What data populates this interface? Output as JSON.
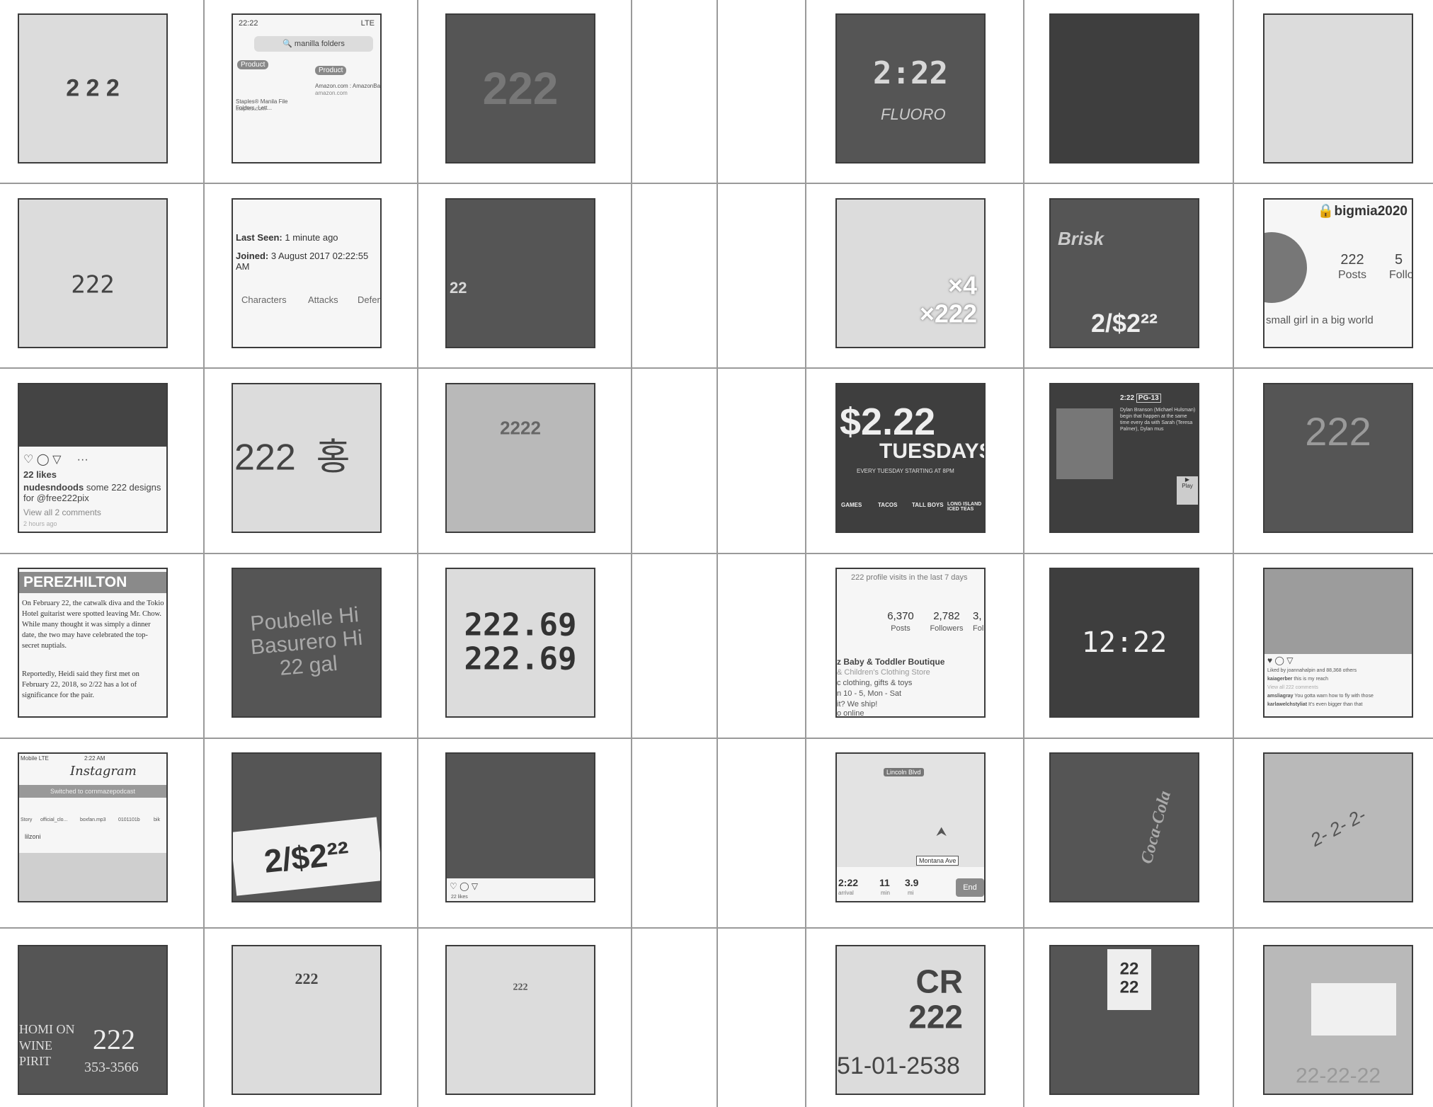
{
  "tiles": {
    "r0c0": {
      "caption": "2 2 2"
    },
    "r0c1": {
      "time": "22:22",
      "signal": "LTE",
      "search": "manilla folders",
      "badge1": "Product",
      "badge2": "Product",
      "item1": "Staples® Manila File Folders, Lett...",
      "item1_source": "staples.com",
      "item2": "Amazon.com : AmazonBasics F",
      "item2_source": "amazon.com"
    },
    "r0c2": {
      "caption": "222"
    },
    "r0c4": {
      "caption": "2:22",
      "sub": "FLUORO"
    },
    "r0c5": {
      "caption": ""
    },
    "r0c6": {
      "caption": ""
    },
    "r1c0": {
      "caption": "222"
    },
    "r1c1": {
      "last_seen_label": "Last Seen:",
      "last_seen": "1 minute ago",
      "joined_label": "Joined:",
      "joined": "3 August 2017 02:22:55 AM",
      "tab1": "Characters",
      "tab2": "Attacks",
      "tab3": "Defen"
    },
    "r1c2": {
      "caption": "22"
    },
    "r1c4": {
      "caption": "×4\n×222"
    },
    "r1c5": {
      "caption": "2/$2²²",
      "brand": "Brisk"
    },
    "r1c6": {
      "username": "bigmia2020",
      "posts_count": "222",
      "posts_label": "Posts",
      "follow_count": "5",
      "follow_label": "Follo",
      "bio": "small girl in a big world"
    },
    "r2c0": {
      "likes": "22 likes",
      "user": "nudesndoods",
      "text": "some 222 designs for @free222pix",
      "comments": "View all 2 comments",
      "time": "2 hours ago"
    },
    "r2c1": {
      "caption": "222  홍"
    },
    "r2c2": {
      "caption": "2222"
    },
    "r2c4": {
      "price": "$2.22",
      "title": "TUESDAYS",
      "sub": "EVERY TUESDAY STARTING AT 8PM",
      "b1": "GAMES",
      "b2": "TACOS",
      "b3": "TALL BOYS",
      "b4": "LONG ISLAND ICED TEAS"
    },
    "r2c5": {
      "time": "2:22",
      "rating": "PG-13",
      "desc": "Dylan Branson (Michael Hulsman) begin that happen at the same time every da with Sarah (Teresa Palmer), Dylan mus",
      "play": "Play"
    },
    "r2c6": {
      "caption": "222"
    },
    "r3c0": {
      "brand": "PEREZHILTON",
      "p1": "On February 22, the catwalk diva and the Tokio Hotel guitarist were spotted leaving Mr. Chow. While many thought it was simply a dinner date, the two may have celebrated the top-secret nuptials.",
      "p2": "Reportedly, Heidi said they first met on February 22, 2018, so 2/22 has a lot of significance for the pair."
    },
    "r3c1": {
      "caption": "Poubelle Hi\nBasurero Hi\n22 gal"
    },
    "r3c2": {
      "caption": "222.69\n222.69"
    },
    "r3c4": {
      "header": "222 profile visits in the last 7 days",
      "posts": "6,370",
      "posts_label": "Posts",
      "followers": "2,782",
      "followers_label": "Followers",
      "following": "3,",
      "following_label": "Foll",
      "name": "z Baby & Toddler Boutique",
      "line1": "& Children's Clothing Store",
      "line2": "c clothing, gifts & toys",
      "line3": "n 10 - 5, Mon - Sat",
      "line4": "it? We ship!",
      "line5": "o online"
    },
    "r3c5": {
      "caption": "12:22"
    },
    "r3c6": {
      "liked_by": "Liked by joannahalpin and 88,368 others",
      "user": "kaiagerber",
      "caption_text": "this is my reach",
      "comments": "View all 222 comments",
      "c1_user": "amsliagray",
      "c1": "You gotta warn how to fly with those",
      "c2_user": "karlawelchstyliat",
      "c2": "It's even bigger than that"
    },
    "r4c0": {
      "carrier": "Mobile  LTE",
      "time": "2:22 AM",
      "app": "Instagram",
      "toast": "Switched to cornmazepodcast",
      "s1": "Story",
      "s2": "official_clo...",
      "s3": "boxfan.mp3",
      "s4": "0101101b",
      "s5": "bik",
      "user": "lilzoni"
    },
    "r4c1": {
      "caption": "2/$2²²"
    },
    "r4c2": {
      "likes": "22 likes"
    },
    "r4c4": {
      "street1": "Lincoln Blvd",
      "street2": "Montana Ave",
      "arrival": "2:22",
      "arrival_label": "arrival",
      "min": "11",
      "min_label": "min",
      "mi": "3.9",
      "mi_label": "mi",
      "end": "End"
    },
    "r4c5": {
      "caption": "Coca-Cola"
    },
    "r4c6": {
      "caption": "2- 2- 2-"
    },
    "r5c0": {
      "caption": "222",
      "phone": "353-3566",
      "side": "HOMI ON\nWINE\nPIRIT"
    },
    "r5c1": {
      "caption": "222"
    },
    "r5c2": {
      "caption": "222"
    },
    "r5c4": {
      "caption": "CR\n222",
      "number": "51-01-2538"
    },
    "r5c5": {
      "caption": "22\n22"
    },
    "r5c6": {
      "caption": "22-22-22"
    }
  }
}
